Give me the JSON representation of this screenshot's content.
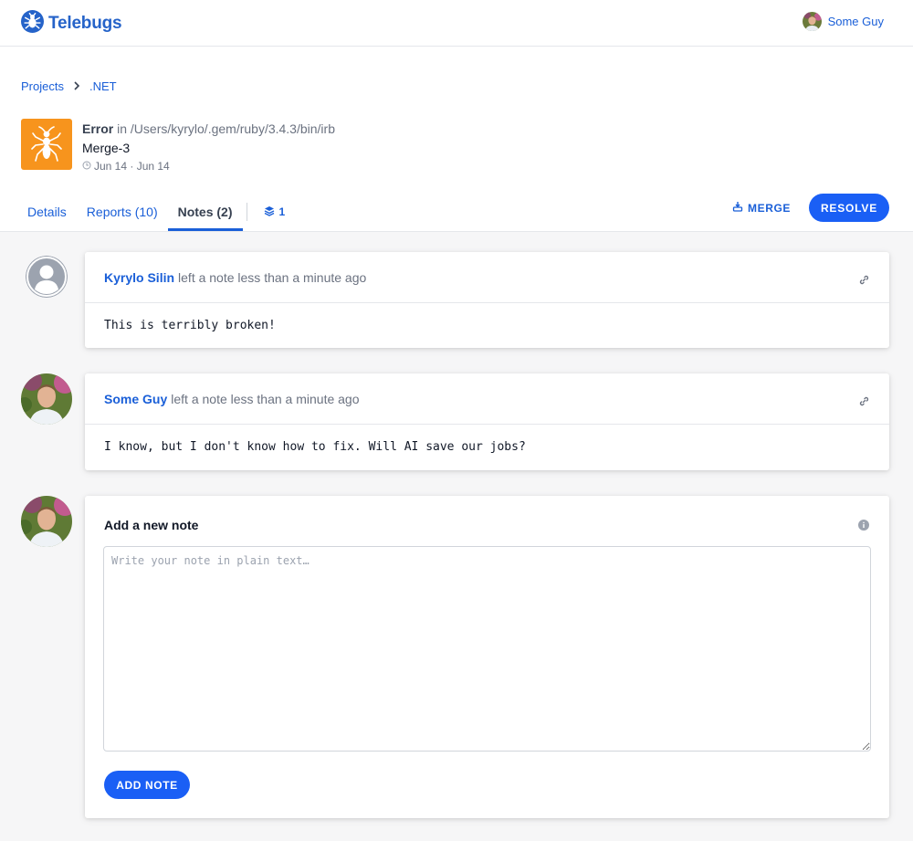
{
  "app": {
    "brand": "Telebugs"
  },
  "user": {
    "name": "Some Guy"
  },
  "breadcrumb": {
    "projects": "Projects",
    "project": ".NET"
  },
  "issue": {
    "type": "Error",
    "location": " in /Users/kyrylo/.gem/ruby/3.4.3/bin/irb",
    "title": "Merge-3",
    "dates": "Jun 14 · Jun 14"
  },
  "tabs": {
    "details": "Details",
    "reports": "Reports (10)",
    "notes": "Notes (2)",
    "stack_count": "1"
  },
  "actions": {
    "merge": "MERGE",
    "resolve": "RESOLVE"
  },
  "notes": [
    {
      "author": "Kyrylo Silin",
      "meta": "left a note less than a minute ago",
      "body": "This is terribly broken!"
    },
    {
      "author": "Some Guy",
      "meta": "left a note less than a minute ago",
      "body": "I know, but I don't know how to fix. Will AI save our jobs?"
    }
  ],
  "new_note": {
    "title": "Add a new note",
    "placeholder": "Write your note in plain text…",
    "button": "ADD NOTE"
  },
  "colors": {
    "accent": "#1a5fd8",
    "button": "#1a5ff5",
    "issue_icon_bg": "#f7941d"
  }
}
